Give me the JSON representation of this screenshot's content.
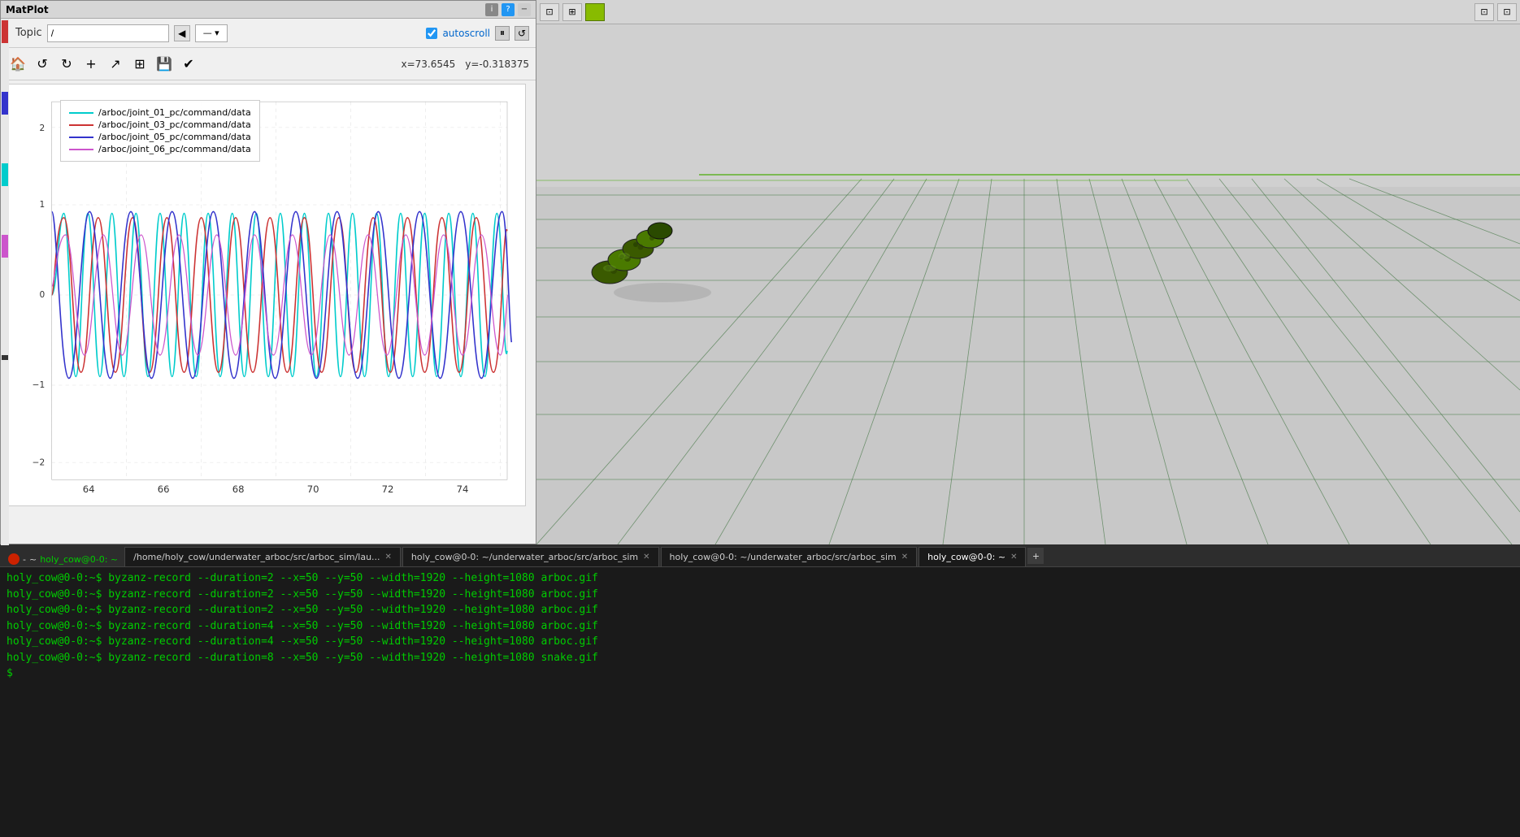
{
  "matplot": {
    "title": "MatPlot",
    "topic_label": "Topic",
    "topic_value": "/",
    "coords": {
      "x": "x=73.6545",
      "y": "y=-0.318375"
    },
    "autoscroll_label": "autoscroll",
    "legend": [
      {
        "id": "line1",
        "label": "/arboc/joint_01_pc/command/data",
        "color": "#00cccc"
      },
      {
        "id": "line2",
        "label": "/arboc/joint_03_pc/command/data",
        "color": "#cc3333"
      },
      {
        "id": "line3",
        "label": "/arboc/joint_05_pc/command/data",
        "color": "#3333cc"
      },
      {
        "id": "line4",
        "label": "/arboc/joint_06_pc/command/data",
        "color": "#cc55cc"
      }
    ],
    "y_axis_labels": [
      "2",
      "1",
      "0",
      "-1",
      "-2"
    ],
    "x_axis_labels": [
      "64",
      "66",
      "68",
      "70",
      "72",
      "74"
    ]
  },
  "terminal": {
    "tabs": [
      {
        "id": "tab1",
        "label": "/home/holy_cow/underwater_arboc/src/arboc_sim/lau...",
        "active": false
      },
      {
        "id": "tab2",
        "label": "holy_cow@0-0: ~/underwater_arboc/src/arboc_sim",
        "active": false
      },
      {
        "id": "tab3",
        "label": "holy_cow@0-0: ~/underwater_arboc/src/arboc_sim",
        "active": false
      },
      {
        "id": "tab4",
        "label": "holy_cow@0-0: ~",
        "active": true
      }
    ],
    "active_tab_label": "holy_cow@0-0: ~",
    "commands": [
      "holy_cow@0-0:~$ byzanz-record --duration=2 --x=50 --y=50 --width=1920 --height=1080 arboc.gif",
      "holy_cow@0-0:~$ byzanz-record --duration=2 --x=50 --y=50 --width=1920 --height=1080 arboc.gif",
      "holy_cow@0-0:~$ byzanz-record --duration=2 --x=50 --y=50 --width=1920 --height=1080 arboc.gif",
      "holy_cow@0-0:~$ byzanz-record --duration=4 --x=50 --y=50 --width=1920 --height=1080 arboc.gif",
      "holy_cow@0-0:~$ byzanz-record --duration=4 --x=50 --y=50 --width=1920 --height=1080 arboc.gif",
      "holy_cow@0-0:~$ byzanz-record --duration=8 --x=50 --y=50 --width=1920 --height=1080 snake.gif"
    ],
    "prompt": "$"
  },
  "icons": {
    "home": "🏠",
    "refresh_cw": "↺",
    "refresh_ccw": "↻",
    "plus": "+",
    "arrow": "↗",
    "grid": "⊞",
    "save": "💾",
    "check": "✔",
    "pause": "⏸",
    "replay": "↺"
  }
}
